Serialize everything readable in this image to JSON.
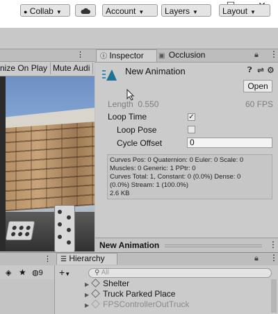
{
  "window": {
    "minimize_glyph": "—",
    "maximize_glyph": "☐",
    "close_glyph": "✕"
  },
  "toolbar": {
    "collab_label": "Collab",
    "account_label": "Account",
    "layers_label": "Layers",
    "layout_label": "Layout"
  },
  "game_view": {
    "maximize_on_play_label": "nize On Play",
    "mute_audio_label": "Mute Audi"
  },
  "inspector": {
    "tab_inspector_label": "Inspector",
    "tab_occlusion_label": "Occlusion",
    "asset_name": "New Animation",
    "open_label": "Open",
    "length_label": "Length",
    "length_value": "0.550",
    "fps_label": "60 FPS",
    "loop_time_label": "Loop Time",
    "loop_time_checked": true,
    "loop_pose_label": "Loop Pose",
    "loop_pose_checked": false,
    "cycle_offset_label": "Cycle Offset",
    "cycle_offset_value": "0",
    "stats": [
      "Curves Pos: 0 Quaternion: 0 Euler: 0 Scale: 0",
      "Muscles: 0 Generic: 1 PPtr: 0",
      "Curves Total: 1, Constant: 0 (0.0%) Dense: 0",
      "(0.0%) Stream: 1 (100.0%)",
      "2.6 KB"
    ],
    "preview_title": "New Animation"
  },
  "project": {
    "count_label": "9"
  },
  "hierarchy": {
    "tab_label": "Hierarchy",
    "search_placeholder": "All",
    "items": [
      {
        "label": "Shelter"
      },
      {
        "label": "Truck Parked Place"
      },
      {
        "label": "FPSControllerOutTruck"
      }
    ]
  },
  "colors": {
    "accent_animation_icon": "#2a8fb8",
    "panel_bg": "#cbcbcb",
    "toolbar_bg": "#c8c8c8"
  }
}
